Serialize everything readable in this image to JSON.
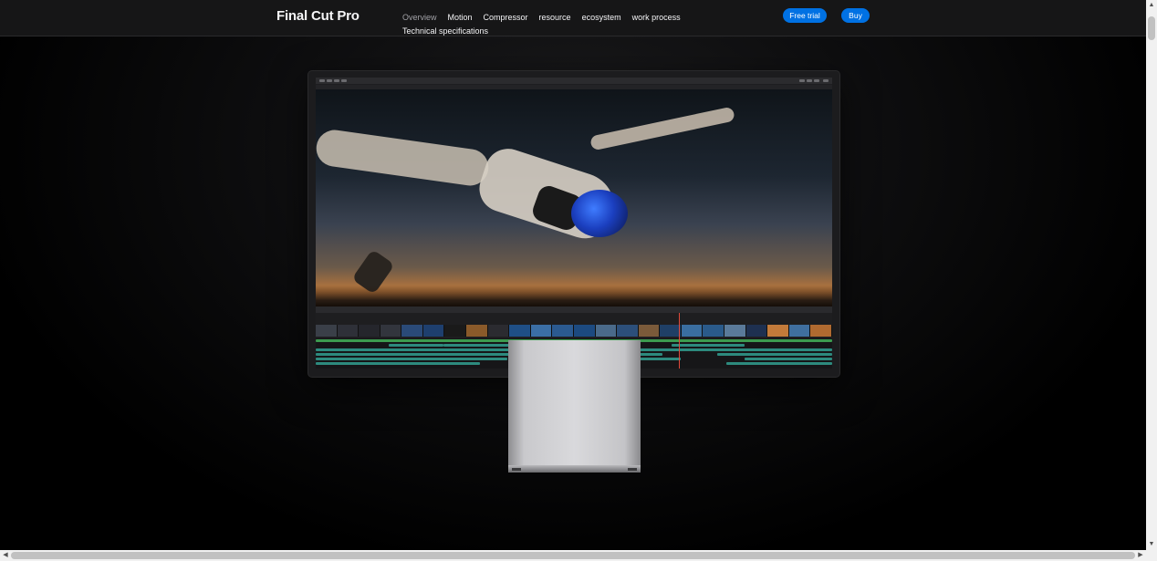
{
  "nav": {
    "brand": "Final Cut Pro",
    "links": [
      {
        "label": "Overview",
        "active": true
      },
      {
        "label": "Motion"
      },
      {
        "label": "Compressor"
      },
      {
        "label": "resource"
      },
      {
        "label": "ecosystem"
      },
      {
        "label": "work process"
      },
      {
        "label": "Technical specifications"
      }
    ],
    "free_trial_label": "Free trial",
    "buy_label": "Buy",
    "accent_color": "#0071e3"
  },
  "hero": {
    "image": "monitor-displaying-final-cut-pro-skydiver"
  },
  "icons": {
    "scroll_up": "up-arrow-icon",
    "scroll_down": "down-arrow-icon",
    "scroll_left": "left-arrow-icon",
    "scroll_right": "right-arrow-icon"
  }
}
